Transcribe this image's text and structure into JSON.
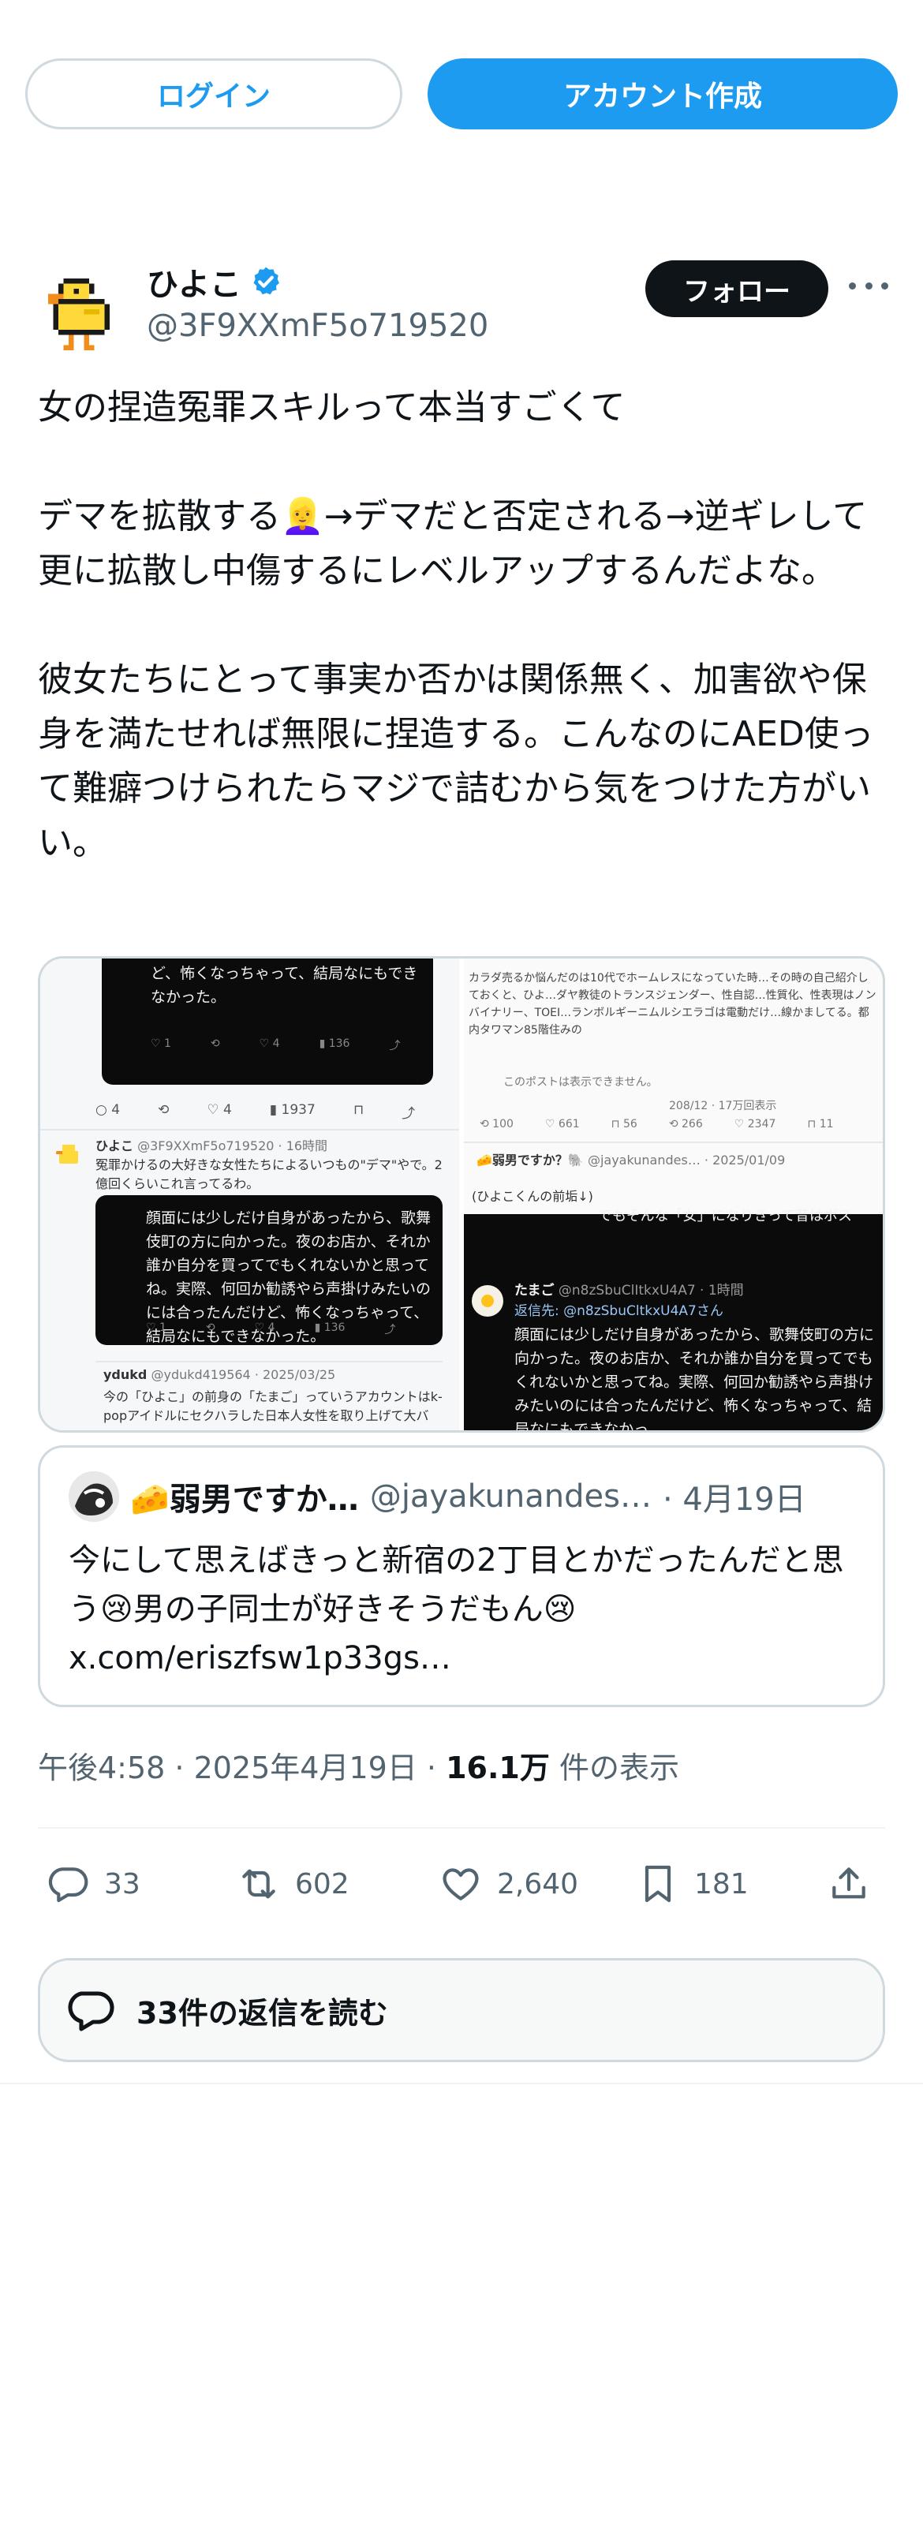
{
  "auth": {
    "login_label": "ログイン",
    "signup_label": "アカウント作成"
  },
  "author": {
    "name": "ひよこ",
    "handle": "@3F9XXmF5o719520",
    "follow_label": "フォロー"
  },
  "tweet": {
    "text": "女の捏造冤罪スキルって本当すごくて\n\nデマを拡散する👱‍♀️→デマだと否定される→逆ギレして更に拡散し中傷するにレベルアップするんだよな。\n\n彼女たちにとって事実か否かは関係無く、加害欲や保身を満たせれば無限に捏造する。こんなのにAED使って難癖つけられたらマジで詰むから気をつけた方がいい。"
  },
  "media": {
    "left": {
      "top_shot_text": "ど、怖くなっちゃって、結局なにもできなかった。",
      "top_shot_stats": [
        "1",
        "4",
        "136"
      ],
      "row_stats": [
        "4",
        "4",
        "1937"
      ],
      "reply_author": "ひよこ",
      "reply_handle": "@3F9XXmF5o719520 · 16時間",
      "reply_text": "冤罪かけるの大好きな女性たちによるいつもの\"デマ\"やで。2億回くらいこれ言ってるわ。",
      "shot_text": "顔面には少しだけ自身があったから、歌舞伎町の方に向かった。夜のお店か、それか誰か自分を買ってでもくれないかと思ってね。実際、何回か勧誘やら声掛けみたいのには合ったんだけど、怖くなっちゃって、結局なにもできなかった。",
      "shot_stats": [
        "1",
        "4",
        "136"
      ],
      "bottom_author": "ydukd",
      "bottom_handle": "@ydukd419564 · 2025/03/25",
      "bottom_text": "今の「ひよこ」の前身の「たまご」っていうアカウントはk-popアイドルにセクハラした日本人女性を取り上げて大バ"
    },
    "right": {
      "top_text": "カラダ売るか悩んだのは10代でホームレスになっていた時…その時の自己紹介しておくと、ひよ…ダヤ教徒のトランスジェンダー、性自認…性質化、性表現はノンバイナリー、TOEI…ランボルギーニムルシエラゴは電動だけ…線かましてる。都内タワマン85階住みの",
      "hidden_note": "このポストは表示できません。",
      "stats_a": [
        "100",
        "661",
        "56"
      ],
      "stats_b": [
        "266",
        "2347",
        "11"
      ],
      "views_note": "208/12 · 17万回表示",
      "quote_author": "🧀弱男ですか？🐘",
      "quote_handle": "@jayakunandes… · 2025/01/09",
      "quote_text": "(ひよこくんの前垢↓)",
      "overlay_text": "でもそんな「女」になりきって昔はボス",
      "reply_author": "たまご",
      "reply_handle": "@n8zSbuClItkxU4A7 · 1時間",
      "reply_to": "返信先: @n8zSbuCltkxU4A7さん",
      "shot_text": "顔面には少しだけ自身があったから、歌舞伎町の方に向かった。夜のお店か、それか誰か自分を買ってでもくれないかと思ってね。実際、何回か勧誘やら声掛けみたいのには合ったんだけど、怖くなっちゃって、結局なにもできなかっ"
    }
  },
  "quote": {
    "name": "🧀弱男ですか…",
    "handle": "@jayakunandes…",
    "date": "· 4月19日",
    "text": "今にして思えばきっと新宿の2丁目とかだったんだと思う😢男の子同士が好きそうだもん😢\nx.com/eriszfsw1p33gs…"
  },
  "meta": {
    "time": "午後4:58",
    "date": "2025年4月19日",
    "views_count": "16.1万",
    "views_label": "件の表示"
  },
  "actions": {
    "replies": "33",
    "retweets": "602",
    "likes": "2,640",
    "bookmarks": "181"
  },
  "read_replies_label": "33件の返信を読む",
  "colors": {
    "accent": "#1d9bf0",
    "text": "#0f1419",
    "muted": "#536471",
    "border": "#cfd9de"
  }
}
